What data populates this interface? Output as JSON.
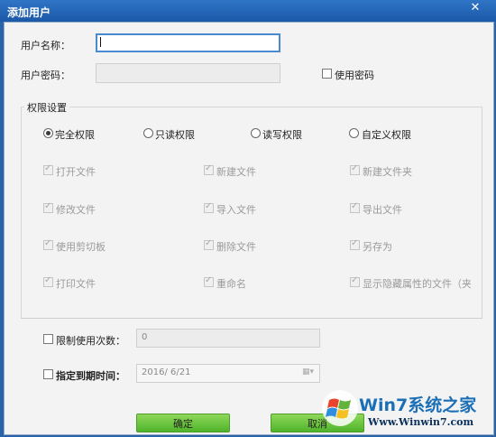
{
  "window": {
    "title": "添加用户",
    "close_glyph": "✕"
  },
  "form": {
    "username_label": "用户名称：",
    "username_value": "",
    "password_label": "用户密码：",
    "password_value": "",
    "use_password_label": "使用密码",
    "use_password_checked": false
  },
  "permissions": {
    "group_title": "权限设置",
    "modes": [
      {
        "label": "完全权限",
        "selected": true
      },
      {
        "label": "只读权限",
        "selected": false
      },
      {
        "label": "读写权限",
        "selected": false
      },
      {
        "label": "自定义权限",
        "selected": false
      }
    ],
    "options": [
      {
        "label": "打开文件",
        "checked": true
      },
      {
        "label": "新建文件",
        "checked": true
      },
      {
        "label": "新建文件夹",
        "checked": true
      },
      {
        "label": "修改文件",
        "checked": true
      },
      {
        "label": "导入文件",
        "checked": true
      },
      {
        "label": "导出文件",
        "checked": true
      },
      {
        "label": "使用剪切板",
        "checked": true
      },
      {
        "label": "删除文件",
        "checked": true
      },
      {
        "label": "另存为",
        "checked": true
      },
      {
        "label": "打印文件",
        "checked": true
      },
      {
        "label": "重命名",
        "checked": true
      },
      {
        "label": "显示隐藏属性的文件（夹",
        "checked": true
      }
    ]
  },
  "limits": {
    "use_count_label": "限制使用次数：",
    "use_count_value": "0",
    "expire_label": "指定到期时间：",
    "expire_value": "2016/  6/21"
  },
  "buttons": {
    "ok": "确定",
    "cancel": "取消"
  },
  "watermark": {
    "brand": "Win7系统之家",
    "url": "Www.Winwin7.com"
  },
  "colors": {
    "title_bar": "#1c58a8",
    "button_green": "#4fb32a",
    "accent": "#4a8ad0"
  }
}
